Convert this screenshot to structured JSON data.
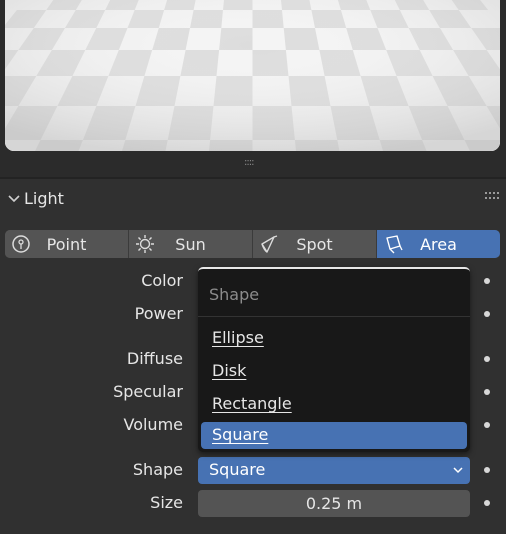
{
  "panel": {
    "title": "Light"
  },
  "light_types": [
    {
      "label": "Point",
      "icon": "point-light-icon",
      "active": false
    },
    {
      "label": "Sun",
      "icon": "sun-light-icon",
      "active": false
    },
    {
      "label": "Spot",
      "icon": "spot-light-icon",
      "active": false
    },
    {
      "label": "Area",
      "icon": "area-light-icon",
      "active": true
    }
  ],
  "properties": {
    "color_label": "Color",
    "power_label": "Power",
    "diffuse_label": "Diffuse",
    "specular_label": "Specular",
    "volume_label": "Volume",
    "shape_label": "Shape",
    "shape_value": "Square",
    "size_label": "Size",
    "size_value": "0.25 m"
  },
  "dropdown": {
    "title": "Shape",
    "options": [
      "Ellipse",
      "Disk",
      "Rectangle",
      "Square"
    ],
    "selected": "Square"
  },
  "colors": {
    "accent": "#4772b3",
    "panel_bg": "#303030",
    "widget_bg": "#545454",
    "menu_bg": "#181818"
  }
}
